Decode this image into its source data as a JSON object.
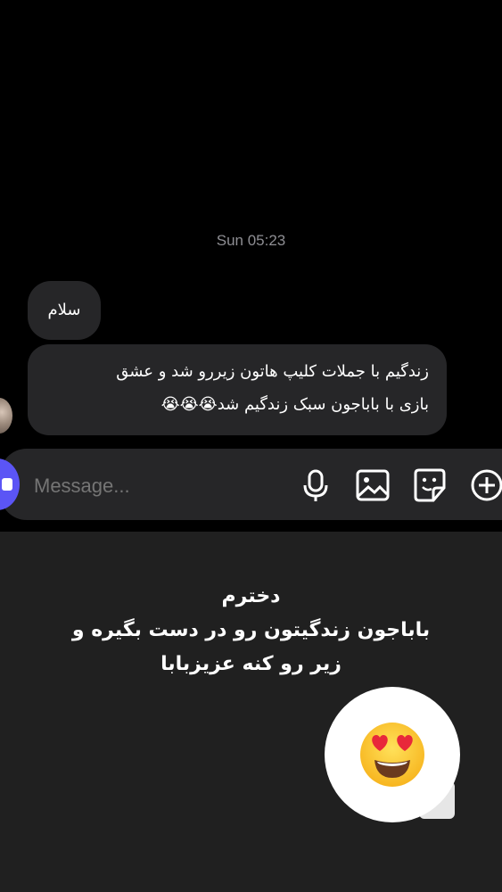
{
  "chat": {
    "timestamp": "Sun 05:23",
    "messages": [
      {
        "text": "سلام"
      },
      {
        "line1": "زندگیم با جملات کلیپ هاتون زیررو شد و عشق",
        "line2": "بازی با باباجون سبک زندگیم شد😭😭😭"
      }
    ]
  },
  "composer": {
    "placeholder": "Message...",
    "icons": [
      "camera-icon",
      "microphone-icon",
      "gallery-icon",
      "sticker-icon",
      "plus-icon"
    ]
  },
  "story": {
    "caption": [
      "دخترم",
      "باباجون زندگیتون رو در دست بگیره و",
      "زیر رو کنه عزیزبابا"
    ],
    "sticker": "heart-eyes-emoji"
  }
}
